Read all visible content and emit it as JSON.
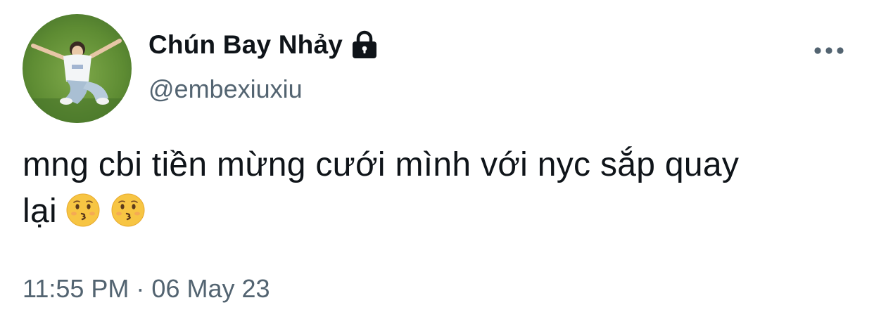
{
  "tweet": {
    "display_name": "Chún Bay Nhảy",
    "handle": "@embexiuxiu",
    "text_line1": "mng cbi tiền mừng cưới mình với nyc sắp quay",
    "text_line2": "lại",
    "emojis": [
      "kissing-face-emoji",
      "kissing-face-emoji"
    ],
    "time": "11:55 PM",
    "separator": "·",
    "date": "06 May 23"
  },
  "icons": {
    "lock": "lock-icon",
    "more": "more-horizontal-icon"
  },
  "colors": {
    "text_primary": "#0f1419",
    "text_secondary": "#536471",
    "background": "#ffffff",
    "emoji_face": "#f7c543"
  }
}
